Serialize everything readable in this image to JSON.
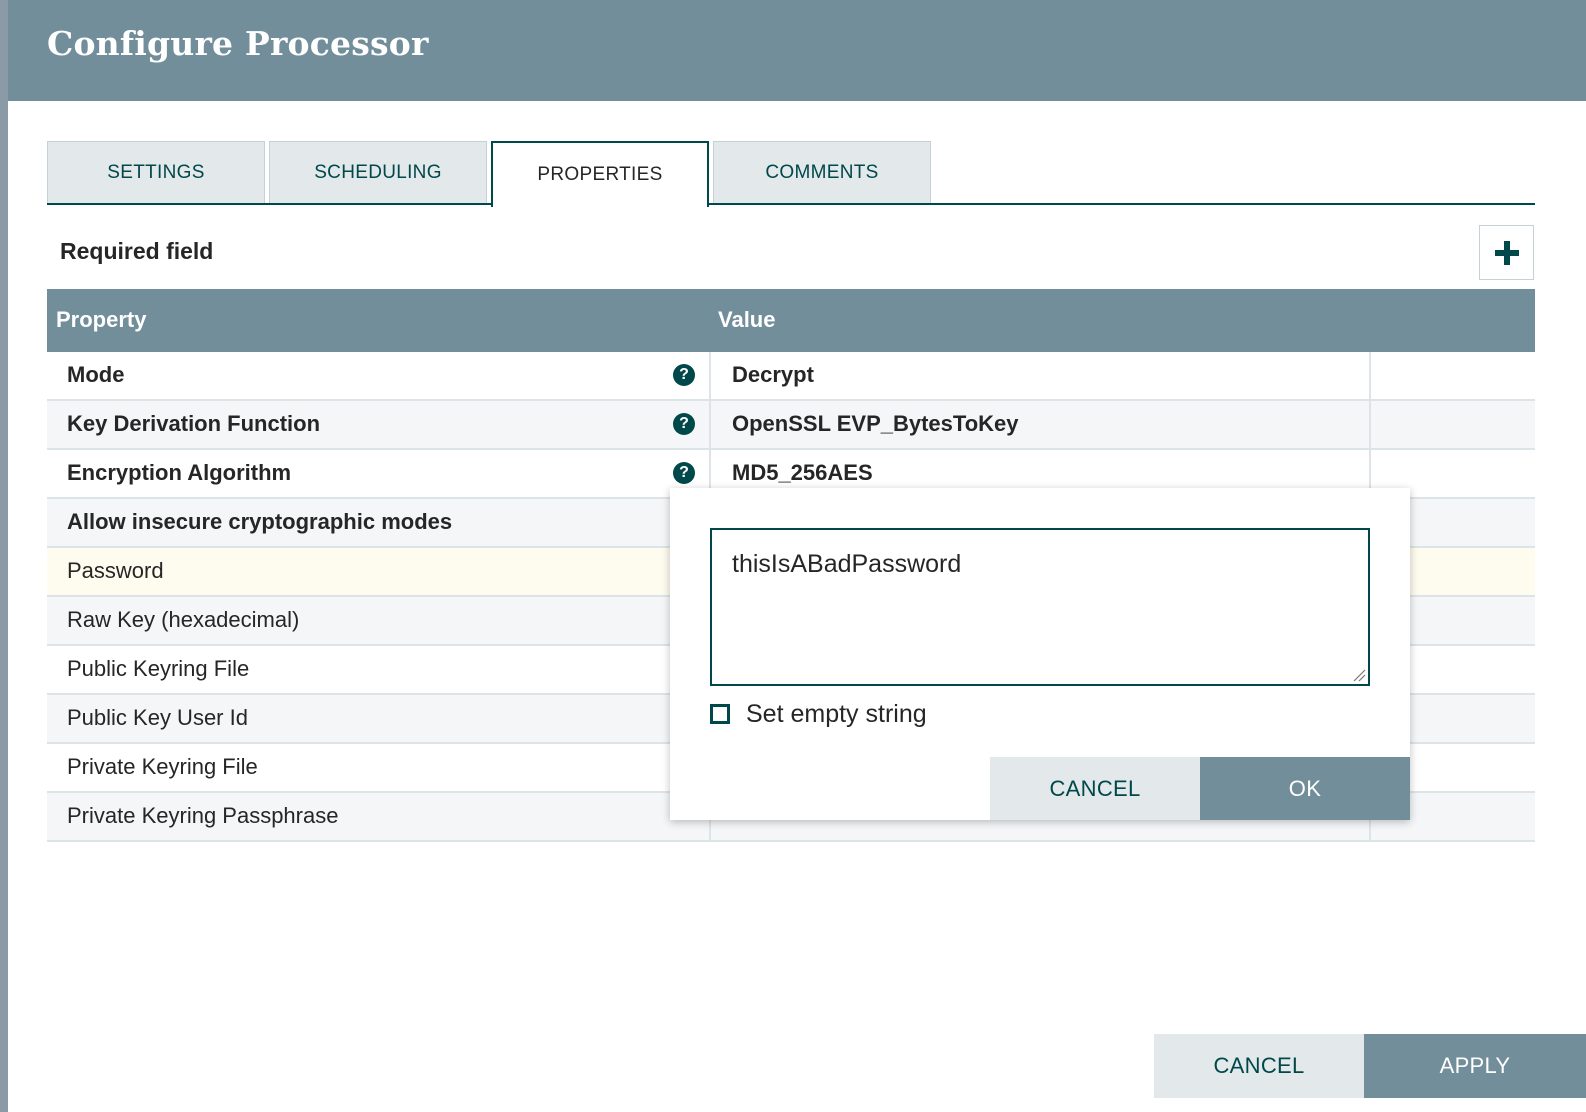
{
  "dialog": {
    "title": "Configure Processor"
  },
  "tabs": [
    {
      "label": "SETTINGS"
    },
    {
      "label": "SCHEDULING"
    },
    {
      "label": "PROPERTIES",
      "active": true
    },
    {
      "label": "COMMENTS"
    }
  ],
  "properties": {
    "required_label": "Required field",
    "add_icon": "plus-icon",
    "columns": {
      "property": "Property",
      "value": "Value"
    },
    "rows": [
      {
        "name": "Mode",
        "value": "Decrypt",
        "required": true,
        "help_icon": "question-circle-icon"
      },
      {
        "name": "Key Derivation Function",
        "value": "OpenSSL EVP_BytesToKey",
        "required": true,
        "help_icon": "question-circle-icon"
      },
      {
        "name": "Encryption Algorithm",
        "value": "MD5_256AES",
        "required": true,
        "help_icon": "question-circle-icon"
      },
      {
        "name": "Allow insecure cryptographic modes",
        "value": "",
        "required": true
      },
      {
        "name": "Password",
        "value": "",
        "required": false,
        "editing": true
      },
      {
        "name": "Raw Key (hexadecimal)",
        "value": "",
        "required": false
      },
      {
        "name": "Public Keyring File",
        "value": "",
        "required": false
      },
      {
        "name": "Public Key User Id",
        "value": "",
        "required": false
      },
      {
        "name": "Private Keyring File",
        "value": "",
        "required": false
      },
      {
        "name": "Private Keyring Passphrase",
        "value": "",
        "required": false
      }
    ]
  },
  "editor": {
    "value": "thisIsABadPassword",
    "empty_string_label": "Set empty string",
    "empty_string_checked": false,
    "cancel_label": "CANCEL",
    "ok_label": "OK"
  },
  "footer": {
    "cancel_label": "CANCEL",
    "apply_label": "APPLY"
  },
  "colors": {
    "header": "#728e9b",
    "accent": "#004849",
    "tab_bg": "#e3e8eb",
    "highlight_row": "#fefcee"
  }
}
